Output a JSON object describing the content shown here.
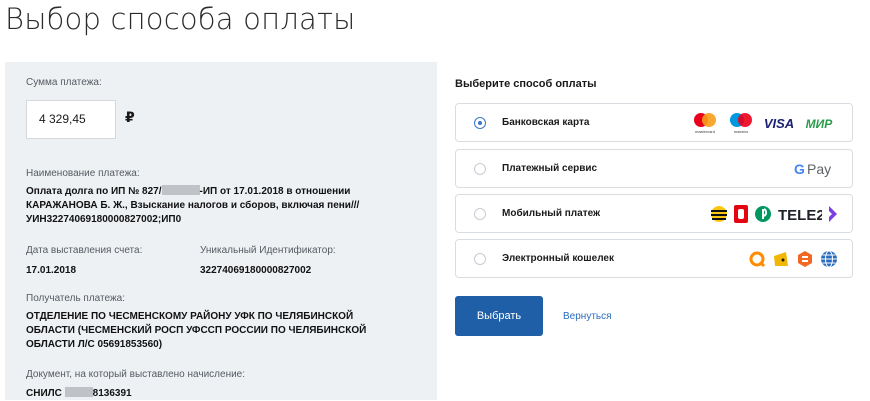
{
  "page": {
    "title": "Выбор способа оплаты"
  },
  "payment": {
    "amount_label": "Сумма платежа:",
    "amount_value": "4 329,45",
    "currency_symbol": "₽",
    "name_label": "Наименование платежа:",
    "name_line1_a": "Оплата долга по ИП № 827/",
    "name_line1_b": "-ИП от 17.01.2018 в отношении",
    "name_line2": "КАРАЖАНОВА Б. Ж., Взыскание налогов и сборов, включая пени///",
    "name_line3": "УИН32274069180000827002;ИП0",
    "issue_date_label": "Дата выставления счета:",
    "issue_date_value": "17.01.2018",
    "uid_label": "Уникальный Идентификатор:",
    "uid_value": "32274069180000827002",
    "recipient_label": "Получатель платежа:",
    "recipient_line1": "ОТДЕЛЕНИЕ ПО ЧЕСМЕНСКОМУ РАЙОНУ УФК ПО ЧЕЛЯБИНСКОЙ",
    "recipient_line2": "ОБЛАСТИ (ЧЕСМЕНСКИЙ РОСП УФССП РОССИИ ПО ЧЕЛЯБИНСКОЙ",
    "recipient_line3": "ОБЛАСТИ Л/С 05691853560)",
    "document_label": "Документ, на который выставлено начисление:",
    "document_prefix": "СНИЛС",
    "document_suffix": "8136391"
  },
  "methods": {
    "title": "Выберите способ оплаты",
    "selected": "card",
    "items": [
      {
        "key": "card",
        "label": "Банковская карта"
      },
      {
        "key": "service",
        "label": "Платежный сервис"
      },
      {
        "key": "mobile",
        "label": "Мобильный платеж"
      },
      {
        "key": "wallet",
        "label": "Электронный кошелек"
      }
    ],
    "brands": {
      "mastercard_caption": "mastercard",
      "maestro_caption": "maestro",
      "visa": "VISA",
      "mir": "МИР",
      "gpay_letter": "G",
      "gpay_text": "Pay",
      "tele2": "TELE2"
    }
  },
  "actions": {
    "select": "Выбрать",
    "back": "Вернуться"
  },
  "colors": {
    "panel_bg": "#eef1f4",
    "primary": "#1f5fa8",
    "link": "#2a6bbd",
    "radio_selected": "#3a78c3"
  }
}
